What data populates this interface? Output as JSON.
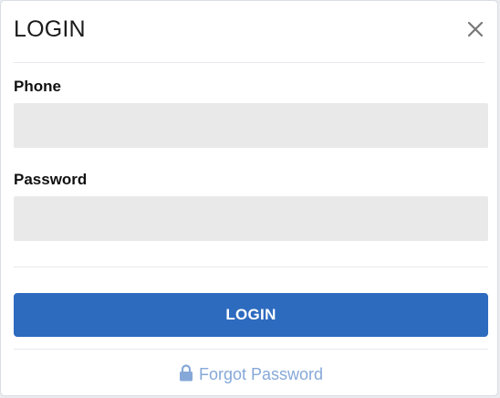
{
  "modal": {
    "title": "LOGIN",
    "close_icon": "close-icon"
  },
  "form": {
    "phone_label": "Phone",
    "phone_value": "",
    "phone_placeholder": "",
    "password_label": "Password",
    "password_value": "",
    "password_placeholder": "",
    "submit_label": "LOGIN"
  },
  "footer": {
    "forgot_label": "Forgot Password",
    "forgot_icon": "lock-icon"
  },
  "colors": {
    "primary": "#2d6bbf",
    "input_bg": "#e9e9e9",
    "link": "#86a8d8"
  }
}
